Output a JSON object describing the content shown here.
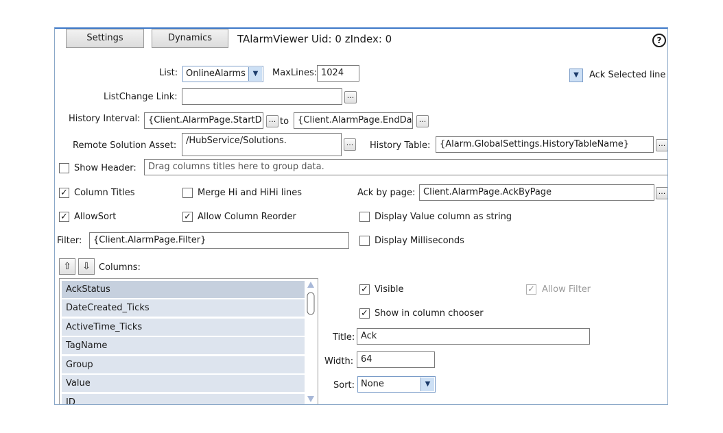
{
  "tabs": {
    "settings": "Settings",
    "dynamics": "Dynamics"
  },
  "header": {
    "title": "TAlarmViewer Uid: 0 zIndex: 0",
    "help_glyph": "?"
  },
  "list": {
    "label": "List:",
    "value": "OnlineAlarms"
  },
  "maxlines": {
    "label": "MaxLines:",
    "value": "1024"
  },
  "ack_selected": {
    "label": "Ack Selected line"
  },
  "listchange": {
    "label": "ListChange Link:",
    "value": ""
  },
  "history_interval": {
    "label": "History Interval:",
    "start": "{Client.AlarmPage.StartD",
    "to": "to",
    "end": "{Client.AlarmPage.EndDa"
  },
  "remote_solution": {
    "label": "Remote Solution Asset:",
    "value": "/HubService/Solutions."
  },
  "history_table": {
    "label": "History Table:",
    "value": "{Alarm.GlobalSettings.HistoryTableName}"
  },
  "show_header": {
    "label": "Show Header:",
    "placeholder": "Drag columns titles here to group data.",
    "checked": false
  },
  "column_titles": {
    "label": "Column Titles",
    "checked": true
  },
  "merge_hihi": {
    "label": "Merge Hi and HiHi lines",
    "checked": false
  },
  "ack_by_page": {
    "label": "Ack by page:",
    "value": "Client.AlarmPage.AckByPage"
  },
  "allow_sort": {
    "label": "AllowSort",
    "checked": true
  },
  "allow_reorder": {
    "label": "Allow Column Reorder",
    "checked": true
  },
  "display_value_string": {
    "label": "Display Value column as string",
    "checked": false
  },
  "filter": {
    "label": "Filter:",
    "value": "{Client.AlarmPage.Filter}"
  },
  "display_ms": {
    "label": "Display Milliseconds",
    "checked": false
  },
  "columns": {
    "label": "Columns:",
    "up_glyph": "⇧",
    "down_glyph": "⇩",
    "items": [
      "AckStatus",
      "DateCreated_Ticks",
      "ActiveTime_Ticks",
      "TagName",
      "Group",
      "Value",
      "ID"
    ],
    "selected": "AckStatus"
  },
  "column_props": {
    "visible": {
      "label": "Visible",
      "checked": true
    },
    "allow_filter": {
      "label": "Allow Filter",
      "checked": true,
      "disabled": true
    },
    "show_in_chooser": {
      "label": "Show in column chooser",
      "checked": true
    },
    "title": {
      "label": "Title:",
      "value": "Ack"
    },
    "width": {
      "label": "Width:",
      "value": "64"
    },
    "sort": {
      "label": "Sort:",
      "value": "None"
    }
  },
  "glyphs": {
    "check": "✓",
    "ellipsis": "...",
    "dropdown": "▼"
  },
  "colors": {
    "accent": "#3c78c8",
    "list_item_bg": "#dde4ee",
    "list_selected_bg": "#c6d0de",
    "combo_arrow_bg": "#cde0f5"
  }
}
